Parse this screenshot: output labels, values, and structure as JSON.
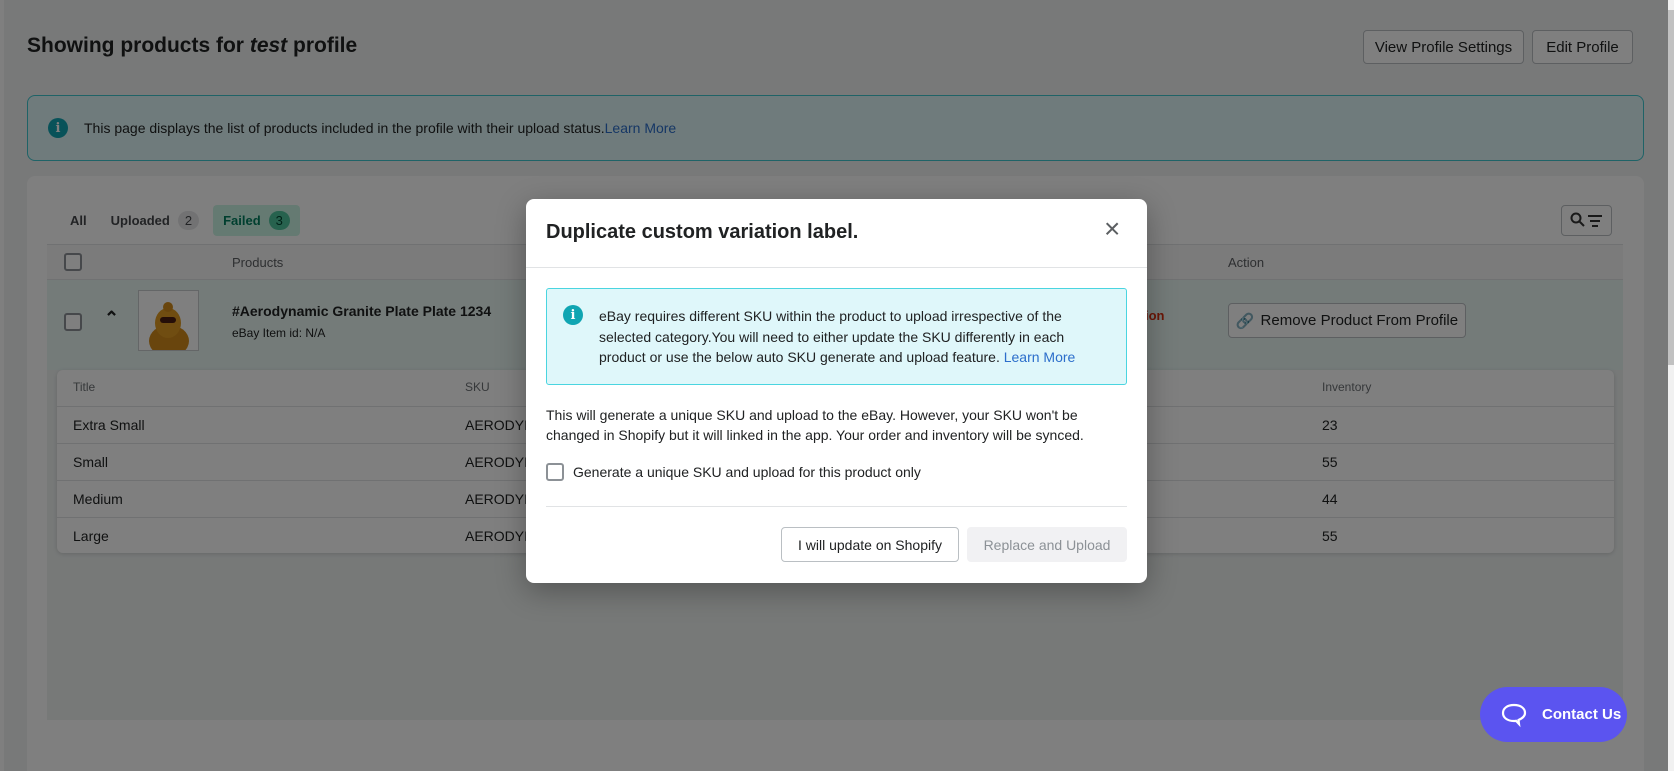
{
  "header": {
    "title_prefix": "Showing products for ",
    "profile_name": "test",
    "title_suffix": " profile",
    "view_settings": "View Profile Settings",
    "edit_profile": "Edit Profile"
  },
  "banner": {
    "text": "This page displays the list of products included in the profile with their upload status.",
    "link": "Learn More"
  },
  "tabs": [
    {
      "label": "All"
    },
    {
      "label": "Uploaded",
      "count": "2"
    },
    {
      "label": "Failed",
      "count": "3"
    }
  ],
  "table": {
    "headers": {
      "products": "Products",
      "action": "Action"
    },
    "product": {
      "title": "#Aerodynamic Granite Plate Plate 1234",
      "item_id": "eBay Item id: N/A",
      "status_fragment": "ion",
      "action": "Remove Product From Profile"
    }
  },
  "variants": {
    "headers": {
      "title": "Title",
      "sku": "SKU",
      "inventory": "Inventory"
    },
    "rows": [
      {
        "title": "Extra Small",
        "sku": "AERODYI",
        "inventory": "23"
      },
      {
        "title": "Small",
        "sku": "AERODYI",
        "inventory": "55"
      },
      {
        "title": "Medium",
        "sku": "AERODYI",
        "inventory": "44"
      },
      {
        "title": "Large",
        "sku": "AERODYI",
        "inventory": "55"
      }
    ]
  },
  "modal": {
    "title": "Duplicate custom variation label.",
    "info": "eBay requires different SKU within the product to upload irrespective of the selected category.You will need to either update the SKU differently in each product or use the below auto SKU generate and upload feature. ",
    "info_link": "Learn More",
    "description": "This will generate a unique SKU and upload to the eBay. However, your SKU won't be changed in Shopify but it will linked in the app. Your order and inventory will be synced.",
    "checkbox_label": "Generate a unique SKU and upload for this product only",
    "secondary": "I will update on Shopify",
    "primary": "Replace and Upload"
  },
  "contact": {
    "label": "Contact Us"
  }
}
